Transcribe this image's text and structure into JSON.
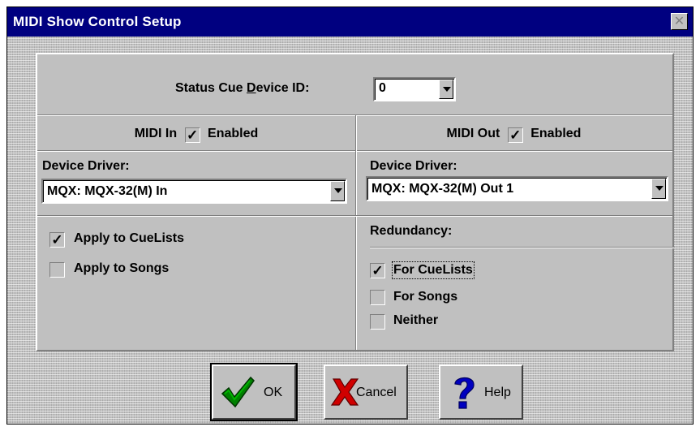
{
  "window": {
    "title": "MIDI Show Control Setup",
    "close_glyph": "✕"
  },
  "status_cue": {
    "label_pre": "Status Cue ",
    "label_underlined": "D",
    "label_post": "evice ID:",
    "value": "0"
  },
  "midi_in": {
    "header_pre": "MIDI In",
    "enabled": true,
    "enabled_label": "Enabled",
    "device_driver_label": "Device Driver:",
    "device_driver_value": "MQX: MQX-32(M) In",
    "options": [
      {
        "label": "Apply to CueLists",
        "checked": true
      },
      {
        "label": "Apply to Songs",
        "checked": false
      }
    ]
  },
  "midi_out": {
    "header_pre": "MIDI Out",
    "enabled": true,
    "enabled_label": "Enabled",
    "device_driver_label": "Device Driver:",
    "device_driver_value": "MQX: MQX-32(M) Out 1",
    "redundancy_label": "Redundancy:",
    "redundancy_options": [
      {
        "label": "For CueLists",
        "checked": true
      },
      {
        "label": "For Songs",
        "checked": false
      },
      {
        "label": "Neither",
        "checked": false
      }
    ]
  },
  "check_glyph": "✓",
  "buttons": {
    "ok": "OK",
    "cancel": "Cancel",
    "help": "Help"
  },
  "icons": {
    "ok": "checkmark-icon",
    "cancel": "x-icon",
    "help": "question-mark-icon"
  }
}
